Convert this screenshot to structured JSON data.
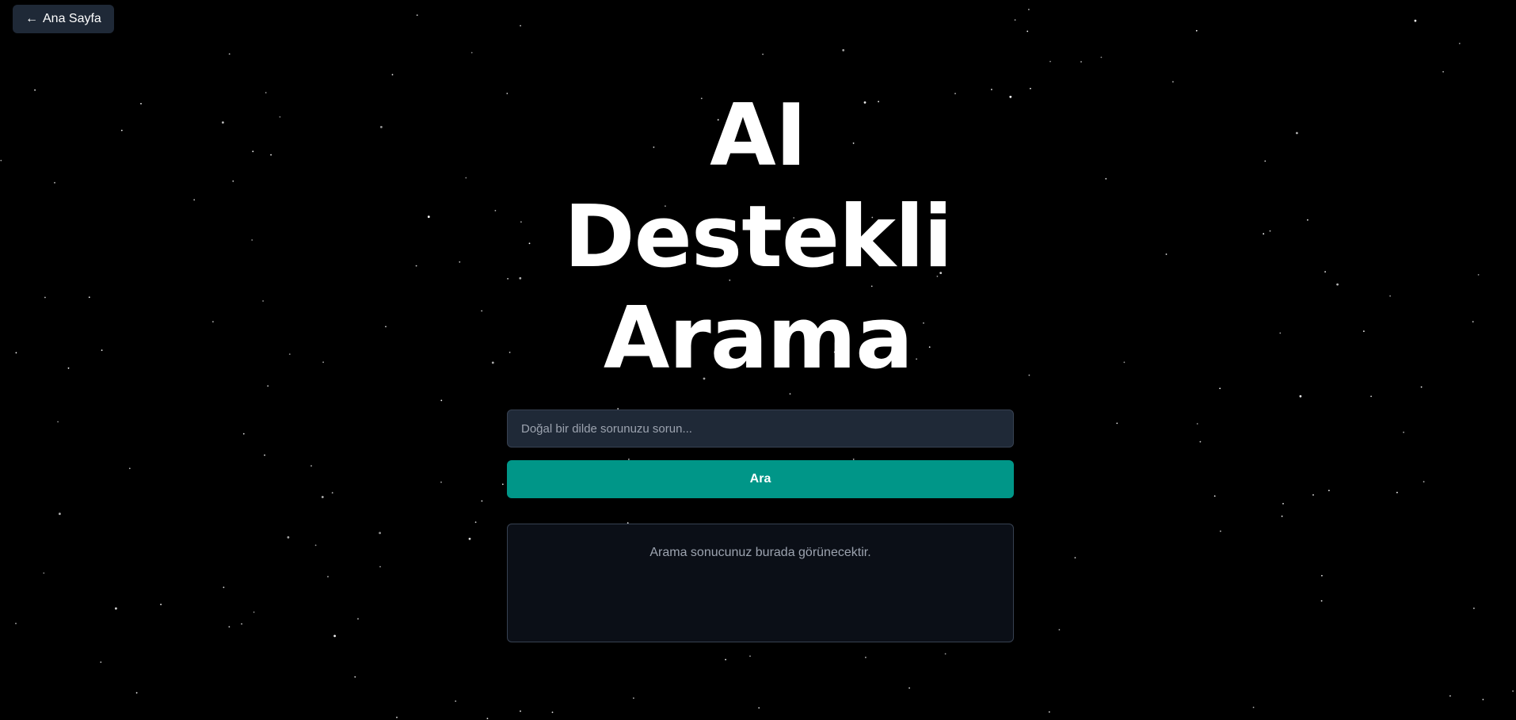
{
  "nav": {
    "back_arrow": "←",
    "back_label": "Ana Sayfa"
  },
  "hero": {
    "lines": [
      "AI",
      "Destekli",
      "Arama"
    ]
  },
  "search": {
    "placeholder": "Doğal bir dilde sorunuzu sorun...",
    "value": "",
    "button_label": "Ara"
  },
  "result": {
    "placeholder_text": "Arama sonucunuz burada görünecektir."
  },
  "colors": {
    "background": "#000000",
    "star": "#ffffff",
    "button_accent": "#009688",
    "input_bg": "#1f2937",
    "panel_bg": "#0b0f17"
  }
}
